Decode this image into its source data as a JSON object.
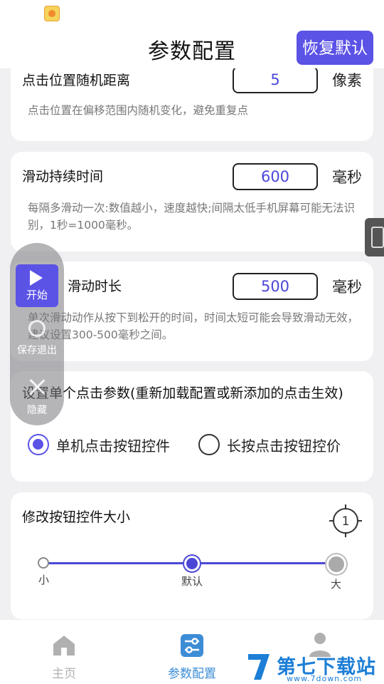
{
  "header": {
    "title": "参数配置",
    "reset_label": "恢复默认"
  },
  "cards": {
    "click_offset": {
      "label": "点击位置随机距离",
      "value": "5",
      "unit": "像素",
      "desc": "点击位置在偏移范围内随机变化，避免重复点"
    },
    "swipe_interval": {
      "label": "滑动持续时间",
      "value": "600",
      "unit": "毫秒",
      "desc": "每隔多滑动一次:数值越小，速度越快;间隔太低手机屏幕可能无法识别，1秒=1000毫秒。"
    },
    "swipe_duration": {
      "label": "滑动时长",
      "value": "500",
      "unit": "毫秒",
      "desc": "单次滑动动作从按下到松开的时间，时间太短可能会导致滑动无效，建议设置300-500毫秒之间。"
    },
    "single_click": {
      "label": "设置单个点击参数(重新加载配置或新添加的点击生效)",
      "options": [
        "单机点击按钮控件",
        "长按点击按钮控价"
      ],
      "selected_index": 0
    },
    "button_size": {
      "label": "修改按钮控件大小",
      "target_number": "1",
      "ticks": [
        "小",
        "默认",
        "大"
      ],
      "selected_index": 1
    }
  },
  "float_panel": {
    "start_label": "开始",
    "save_label": "保存退出",
    "hide_label": "隐藏"
  },
  "bottom_nav": {
    "items": [
      {
        "label": "主页",
        "active": false
      },
      {
        "label": "参数配置",
        "active": true
      },
      {
        "label": "",
        "active": false
      }
    ]
  },
  "watermark": {
    "text": "第七下载站",
    "url": "www.7down.com"
  },
  "colors": {
    "accent": "#5b52e6",
    "value_text": "#4b47d6",
    "inactive_nav": "#b0b0b0",
    "watermark": "#1c7ed6"
  }
}
